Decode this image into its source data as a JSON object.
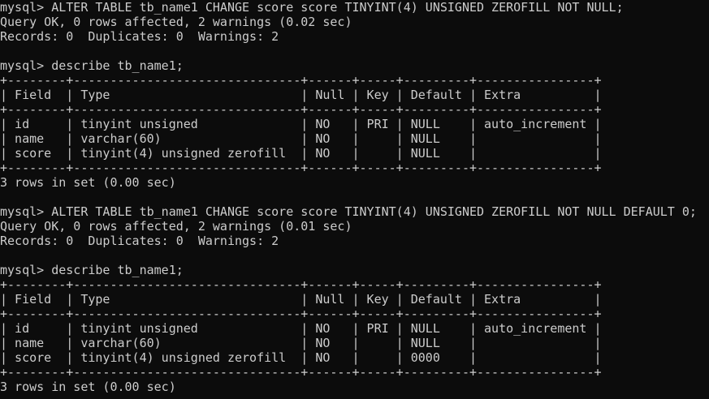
{
  "terminal": {
    "colors": {
      "background": "#0c0c0c",
      "foreground": "#cccccc"
    },
    "lines": [
      "mysql> ALTER TABLE tb_name1 CHANGE score score TINYINT(4) UNSIGNED ZEROFILL NOT NULL;",
      "Query OK, 0 rows affected, 2 warnings (0.02 sec)",
      "Records: 0  Duplicates: 0  Warnings: 2",
      "",
      "mysql> describe tb_name1;",
      "+--------+-------------------------------+------+-----+---------+----------------+",
      "| Field  | Type                          | Null | Key | Default | Extra          |",
      "+--------+-------------------------------+------+-----+---------+----------------+",
      "| id     | tinyint unsigned              | NO   | PRI | NULL    | auto_increment |",
      "| name   | varchar(60)                   | NO   |     | NULL    |                |",
      "| score  | tinyint(4) unsigned zerofill  | NO   |     | NULL    |                |",
      "+--------+-------------------------------+------+-----+---------+----------------+",
      "3 rows in set (0.00 sec)",
      "",
      "mysql> ALTER TABLE tb_name1 CHANGE score score TINYINT(4) UNSIGNED ZEROFILL NOT NULL DEFAULT 0;",
      "Query OK, 0 rows affected, 2 warnings (0.01 sec)",
      "Records: 0  Duplicates: 0  Warnings: 2",
      "",
      "mysql> describe tb_name1;",
      "+--------+-------------------------------+------+-----+---------+----------------+",
      "| Field  | Type                          | Null | Key | Default | Extra          |",
      "+--------+-------------------------------+------+-----+---------+----------------+",
      "| id     | tinyint unsigned              | NO   | PRI | NULL    | auto_increment |",
      "| name   | varchar(60)                   | NO   |     | NULL    |                |",
      "| score  | tinyint(4) unsigned zerofill  | NO   |     | 0000    |                |",
      "+--------+-------------------------------+------+-----+---------+----------------+",
      "3 rows in set (0.00 sec)"
    ]
  }
}
